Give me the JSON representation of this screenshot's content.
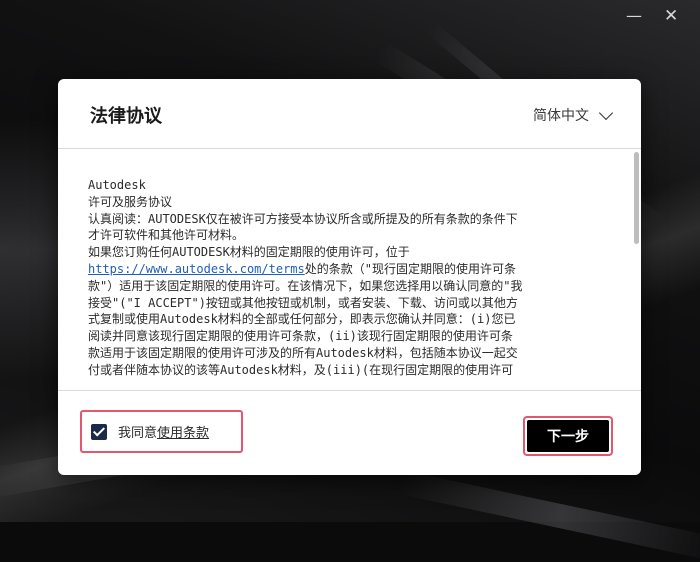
{
  "window": {
    "minimize_glyph": "—",
    "close_glyph": "✕"
  },
  "dialog": {
    "title": "法律协议",
    "language": "简体中文"
  },
  "terms": {
    "lines": [
      "Autodesk",
      "许可及服务协议",
      "认真阅读：AUTODESK仅在被许可方接受本协议所含或所提及的所有条款的条件下",
      "才许可软件和其他许可材料。",
      "如果您订购任何AUTODESK材料的固定期限的使用许可，位于",
      "处的条款（\"现行固定期限的使用许可条",
      "款\"）适用于该固定期限的使用许可。在该情况下，如果您选择用以确认同意的\"我",
      "接受\"(\"I ACCEPT\")按钮或其他按钮或机制，或者安装、下载、访问或以其他方",
      "式复制或使用Autodesk材料的全部或任何部分，即表示您确认并同意：(i)您已",
      "阅读并同意该现行固定期限的使用许可条款，(ii)该现行固定期限的使用许可条",
      "款适用于该固定期限的使用许可涉及的所有Autodesk材料，包括随本协议一起交",
      "付或者伴随本协议的该等Autodesk材料，及(iii)(在现行固定期限的使用许可"
    ],
    "link": "https://www.autodesk.com/terms"
  },
  "agree": {
    "checked": true,
    "label": "我同意",
    "link_text": "使用条款"
  },
  "buttons": {
    "next": "下一步"
  },
  "colors": {
    "highlight": "#e4566c",
    "checkbox": "#1c2a4a",
    "link": "#1f5fb8",
    "primary_button": "#000000"
  }
}
